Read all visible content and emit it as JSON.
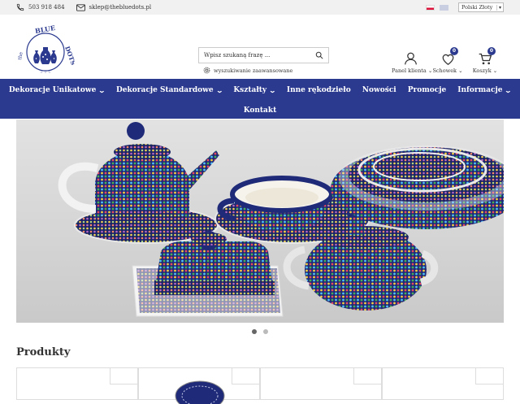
{
  "topbar": {
    "phone": "503 918 484",
    "email": "sklep@thebluedots.pl",
    "language_select": "Polski Złoty"
  },
  "logo": {
    "text_top": "the",
    "text_brand": "BLUE DOTS"
  },
  "search": {
    "placeholder": "Wpisz szukaną frazę ...",
    "advanced_label": "wyszukiwanie zaawansowane"
  },
  "header_icons": {
    "account_label": "Panel klienta",
    "wishlist_label": "Schowek",
    "wishlist_count": "0",
    "cart_label": "Koszyk",
    "cart_count": "0"
  },
  "nav": {
    "items": [
      {
        "label": "Dekoracje Unikatowe",
        "dropdown": true
      },
      {
        "label": "Dekoracje Standardowe",
        "dropdown": true
      },
      {
        "label": "Kształty",
        "dropdown": true
      },
      {
        "label": "Inne rękodzieło",
        "dropdown": false
      },
      {
        "label": "Nowości",
        "dropdown": false
      },
      {
        "label": "Promocje",
        "dropdown": false
      },
      {
        "label": "Informacje",
        "dropdown": true
      },
      {
        "label": "Kontakt",
        "dropdown": false
      }
    ]
  },
  "slider": {
    "slides": 2,
    "active_slide": 1
  },
  "products": {
    "title": "Produkty"
  },
  "colors": {
    "brand_blue": "#2b3a8f",
    "topbar_bg": "#f1f1f1"
  }
}
